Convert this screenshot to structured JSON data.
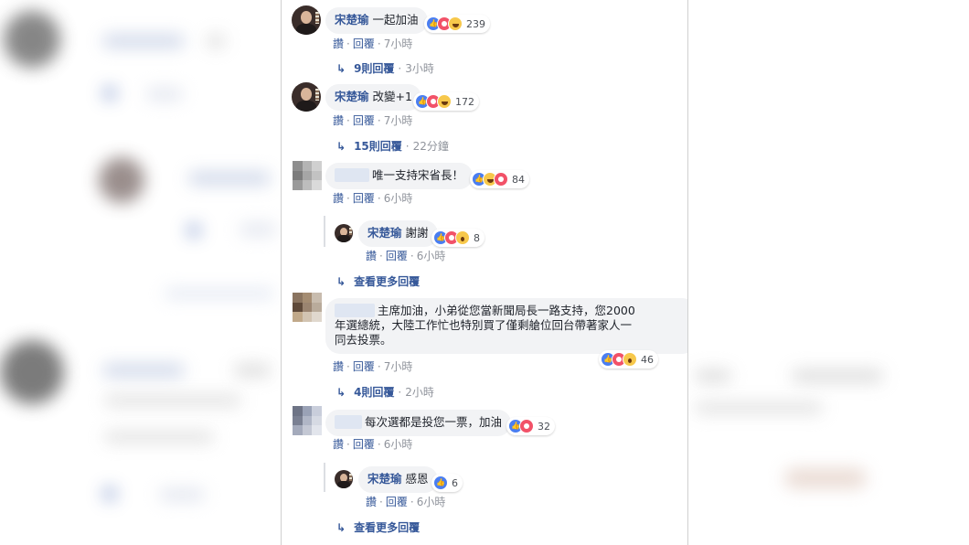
{
  "actions": {
    "like": "讚",
    "reply": "回覆",
    "sep": "·"
  },
  "comments": [
    {
      "name": "宋楚瑜",
      "text": "一起加油",
      "count": "239",
      "time": "7小時",
      "replies_label": "9則回覆",
      "replies_time": "3小時"
    },
    {
      "name": "宋楚瑜",
      "text": "改變+1",
      "count": "172",
      "time": "7小時",
      "replies_label": "15則回覆",
      "replies_time": "22分鐘"
    },
    {
      "name": "",
      "text": "唯一支持宋省長！",
      "count": "84",
      "time": "6小時"
    },
    {
      "name": "宋楚瑜",
      "text": "謝謝",
      "count": "8",
      "time": "6小時",
      "more_label": "查看更多回覆"
    },
    {
      "name": "",
      "text_lines": [
        "主席加油，小弟從您當新聞局長一路支持，您2000",
        "年選總統，大陸工作忙也特別買了僅剩艙位回台帶著家人一",
        "同去投票。"
      ],
      "count": "46",
      "time": "7小時",
      "replies_label": "4則回覆",
      "replies_time": "2小時"
    },
    {
      "name": "",
      "text": "每次選都是投您一票，加油",
      "count": "32",
      "time": "6小時"
    },
    {
      "name": "宋楚瑜",
      "text": "感恩",
      "count": "6",
      "time": "6小時",
      "more_label": "查看更多回覆"
    }
  ],
  "reaction_icons": [
    "like-icon",
    "love-icon",
    "haha-icon",
    "wow-icon"
  ],
  "colors": {
    "link": "#365899",
    "bubble": "#f2f3f5",
    "muted": "#90949c",
    "like": "#4a7ef1",
    "love": "#f25268",
    "emoji": "#f7c84b"
  }
}
